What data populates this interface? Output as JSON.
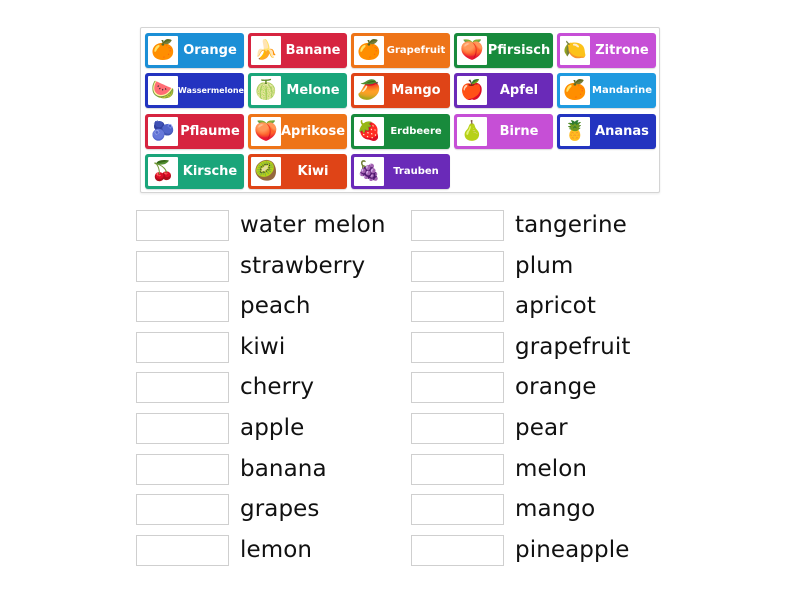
{
  "tiles": [
    {
      "label": "Orange",
      "color": "#1b8fd6",
      "icon": "orange-icon",
      "glyph": "🍊",
      "size": "normal"
    },
    {
      "label": "Banane",
      "color": "#d62440",
      "icon": "banana-icon",
      "glyph": "🍌",
      "size": "normal"
    },
    {
      "label": "Grapefruit",
      "color": "#ee7418",
      "icon": "grapefruit-icon",
      "glyph": "🍊",
      "size": "small"
    },
    {
      "label": "Pfirsisch",
      "color": "#188a3c",
      "icon": "peach-icon",
      "glyph": "🍑",
      "size": "normal"
    },
    {
      "label": "Zitrone",
      "color": "#c64fd6",
      "icon": "lemon-icon",
      "glyph": "🍋",
      "size": "normal"
    },
    {
      "label": "Wassermelone",
      "color": "#2334c0",
      "icon": "watermelon-icon",
      "glyph": "🍉",
      "size": "xsmall"
    },
    {
      "label": "Melone",
      "color": "#1aa57a",
      "icon": "melon-icon",
      "glyph": "🍈",
      "size": "normal"
    },
    {
      "label": "Mango",
      "color": "#df4417",
      "icon": "mango-icon",
      "glyph": "🥭",
      "size": "normal"
    },
    {
      "label": "Apfel",
      "color": "#6a2ab8",
      "icon": "apple-icon",
      "glyph": "🍎",
      "size": "normal"
    },
    {
      "label": "Mandarine",
      "color": "#1f9ae0",
      "icon": "tangerine-icon",
      "glyph": "🍊",
      "size": "small"
    },
    {
      "label": "Pflaume",
      "color": "#d62440",
      "icon": "plum-icon",
      "glyph": "🫐",
      "size": "normal"
    },
    {
      "label": "Aprikose",
      "color": "#ee7418",
      "icon": "apricot-icon",
      "glyph": "🍑",
      "size": "normal"
    },
    {
      "label": "Erdbeere",
      "color": "#188a3c",
      "icon": "strawberry-icon",
      "glyph": "🍓",
      "size": "small"
    },
    {
      "label": "Birne",
      "color": "#c64fd6",
      "icon": "pear-icon",
      "glyph": "🍐",
      "size": "normal"
    },
    {
      "label": "Ananas",
      "color": "#2334c0",
      "icon": "pineapple-icon",
      "glyph": "🍍",
      "size": "normal"
    },
    {
      "label": "Kirsche",
      "color": "#1aa57a",
      "icon": "cherry-icon",
      "glyph": "🍒",
      "size": "normal"
    },
    {
      "label": "Kiwi",
      "color": "#df4417",
      "icon": "kiwi-icon",
      "glyph": "🥝",
      "size": "normal"
    },
    {
      "label": "Trauben",
      "color": "#6a2ab8",
      "icon": "grapes-icon",
      "glyph": "🍇",
      "size": "small"
    }
  ],
  "targets_left": [
    "water melon",
    "strawberry",
    "peach",
    "kiwi",
    "cherry",
    "apple",
    "banana",
    "grapes",
    "lemon"
  ],
  "targets_right": [
    "tangerine",
    "plum",
    "apricot",
    "grapefruit",
    "orange",
    "pear",
    "melon",
    "mango",
    "pineapple"
  ]
}
